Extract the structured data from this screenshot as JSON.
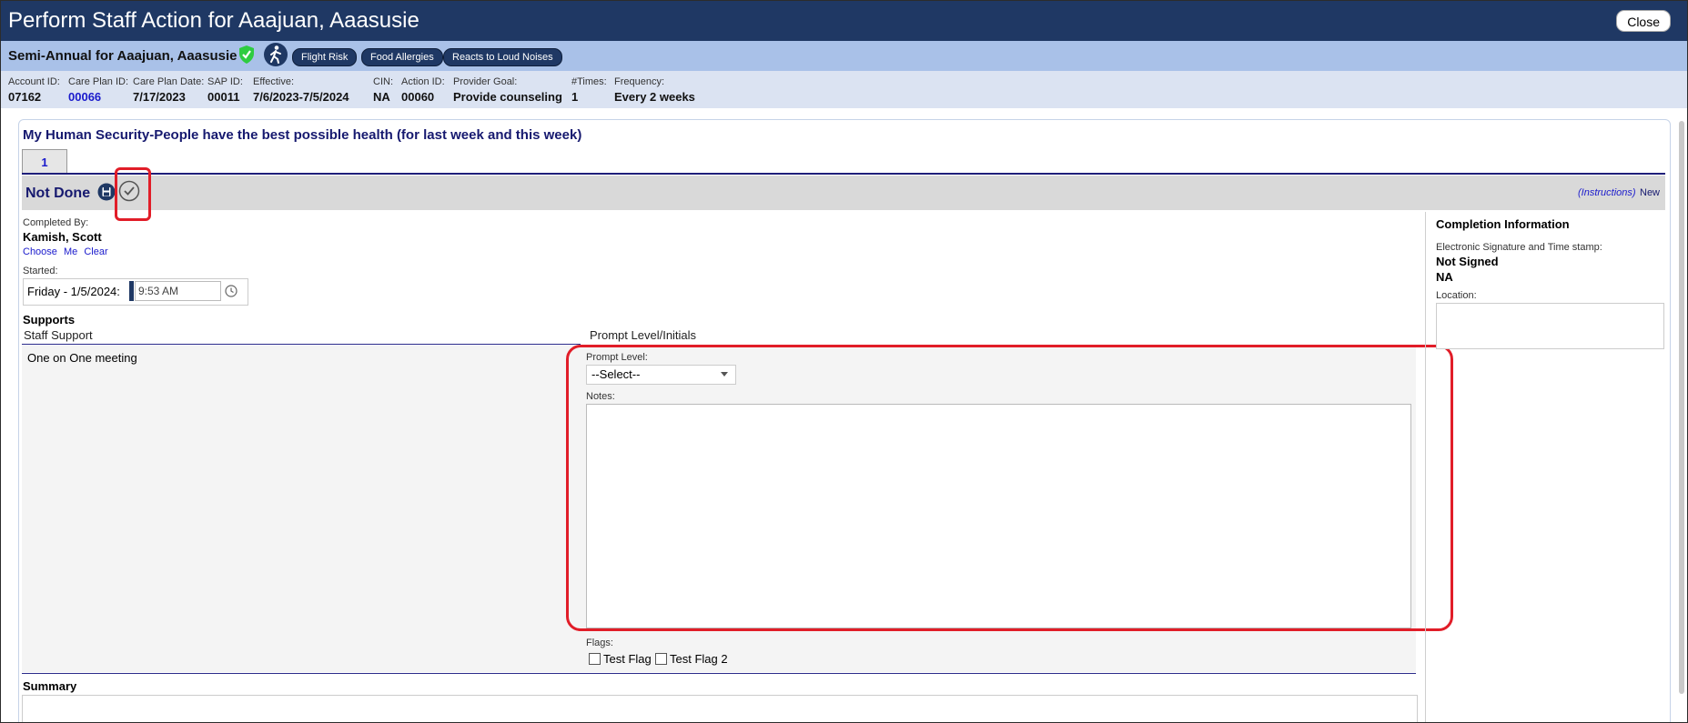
{
  "window": {
    "title": "Perform Staff Action for Aaajuan, Aaasusie",
    "close_label": "Close"
  },
  "subheader": {
    "title": "Semi-Annual for Aaajuan, Aaasusie",
    "tags": [
      "Flight Risk",
      "Food Allergies",
      "Reacts to Loud Noises"
    ]
  },
  "info": [
    {
      "label": "Account ID:",
      "value": "07162"
    },
    {
      "label": "Care Plan ID:",
      "value": "00066"
    },
    {
      "label": "Care Plan Date:",
      "value": "7/17/2023"
    },
    {
      "label": "SAP ID:",
      "value": "00011"
    },
    {
      "label": "Effective:",
      "value": "7/6/2023-7/5/2024"
    },
    {
      "label": "CIN:",
      "value": "NA"
    },
    {
      "label": "Action ID:",
      "value": "00060"
    },
    {
      "label": "Provider Goal:",
      "value": "Provide counseling"
    },
    {
      "label": "#Times:",
      "value": "1"
    },
    {
      "label": "Frequency:",
      "value": "Every 2 weeks"
    }
  ],
  "goal": "My Human Security-People have the best possible health (for last week and this week)",
  "tab_label": "1",
  "status": "Not Done",
  "instructions_link": "(Instructions)",
  "new_label": "New",
  "completed_by": {
    "label": "Completed By:",
    "name": "Kamish, Scott",
    "choose": "Choose",
    "me": "Me",
    "clear": "Clear"
  },
  "started": {
    "label": "Started:",
    "day": "Friday - 1/5/2024:",
    "time": "9:53 AM"
  },
  "supports": {
    "title": "Supports",
    "col_staff": "Staff Support",
    "col_prompt": "Prompt Level/Initials",
    "item": "One on One meeting"
  },
  "prompt": {
    "label": "Prompt Level:",
    "selected": "--Select--"
  },
  "notes_label": "Notes:",
  "flags": {
    "label": "Flags:",
    "items": [
      "Test Flag",
      "Test Flag 2"
    ]
  },
  "summary_label": "Summary",
  "completion": {
    "title": "Completion Information",
    "sig_label": "Electronic Signature and Time stamp:",
    "signed": "Not Signed",
    "na": "NA",
    "location_label": "Location:"
  },
  "colors": {
    "header_navy": "#1f3864",
    "subheader_blue": "#a9c1e8",
    "highlight_red": "#e11d28",
    "shield_green": "#2ecc40"
  }
}
